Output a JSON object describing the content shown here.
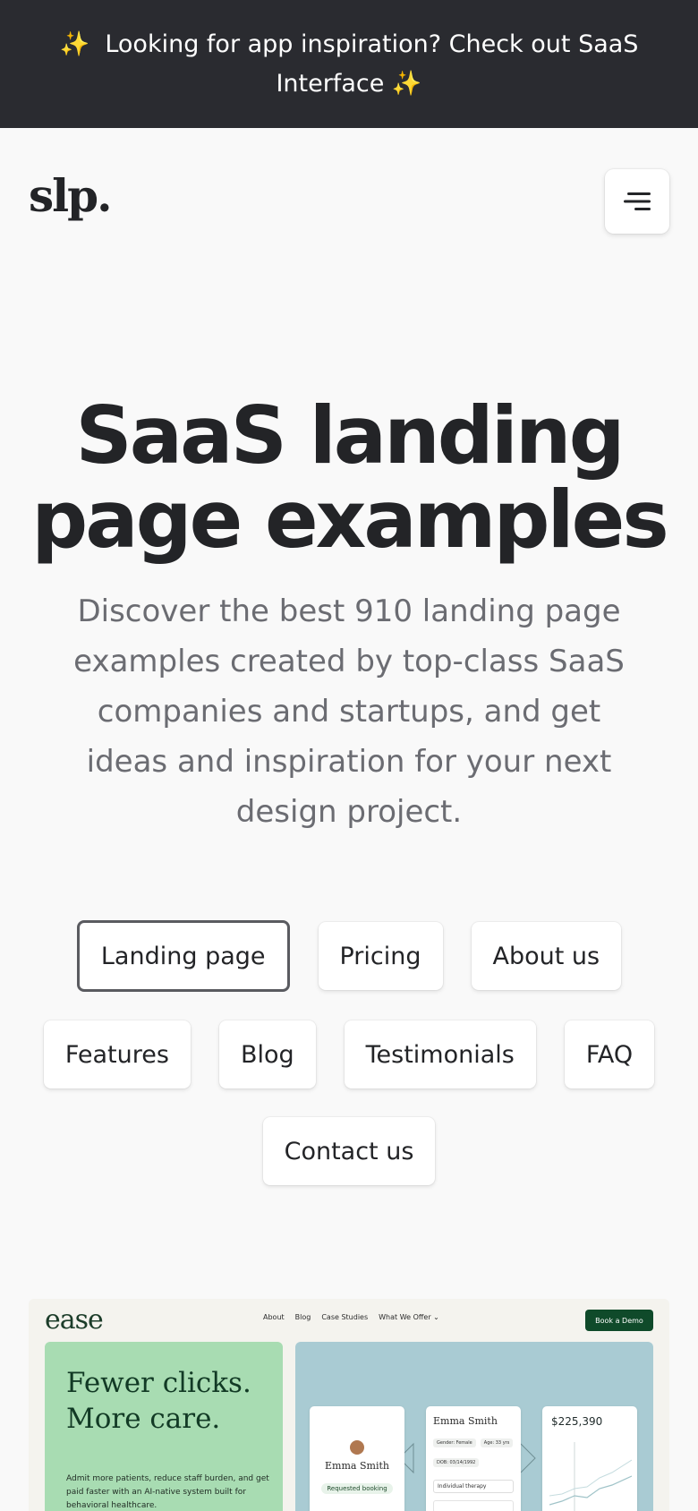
{
  "banner": {
    "text": "Looking for app inspiration? Check out SaaS Interface",
    "sparkle": "✨"
  },
  "header": {
    "logo": "slp.",
    "menu_icon": "menu-icon"
  },
  "hero": {
    "title": "SaaS landing page examples",
    "subtitle": "Discover the best 910 landing page examples created by top-class SaaS companies and startups, and get ideas and inspiration for your next design project."
  },
  "tags": [
    {
      "label": "Landing page",
      "active": true
    },
    {
      "label": "Pricing",
      "active": false
    },
    {
      "label": "About us",
      "active": false
    },
    {
      "label": "Features",
      "active": false
    },
    {
      "label": "Blog",
      "active": false
    },
    {
      "label": "Testimonials",
      "active": false
    },
    {
      "label": "FAQ",
      "active": false
    },
    {
      "label": "Contact us",
      "active": false
    }
  ],
  "preview": {
    "logo": "ease",
    "nav": [
      "About",
      "Blog",
      "Case Studies",
      "What We Offer ⌄"
    ],
    "cta": "Book a Demo",
    "headline": "Fewer clicks. More care.",
    "body": "Admit more patients, reduce staff burden, and get paid faster with an AI-native system built for behavioral healthcare.",
    "card1": {
      "name": "Emma Smith",
      "badge": "Requested booking"
    },
    "card2": {
      "name": "Emma Smith",
      "chips": [
        "Gender: Female",
        "Age: 33 yrs",
        "DOB: 03/14/1992"
      ],
      "select": "Individual therapy"
    },
    "card3": {
      "amount": "$225,390"
    }
  },
  "colors": {
    "banner_bg": "#2a2b30",
    "page_bg": "#f9f9f9",
    "text": "#232427",
    "muted": "#6b6c72"
  }
}
